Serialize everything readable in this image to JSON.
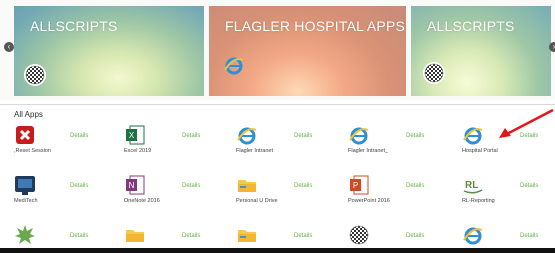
{
  "banners": [
    {
      "title": "ALLSCRIPTS",
      "logo": "checkered-ball-icon"
    },
    {
      "title": "FLAGLER HOSPITAL APPS",
      "logo": "ie-icon"
    },
    {
      "title": "ALLSCRIPTS",
      "logo": "checkered-ball-icon"
    }
  ],
  "nav": {
    "prev": "‹",
    "next": "›"
  },
  "all_apps_label": "All Apps",
  "details_label": "Details",
  "apps": [
    {
      "name": ",Reset Session",
      "icon": "red-x-icon"
    },
    {
      "name": "Excel 2019",
      "icon": "excel-icon"
    },
    {
      "name": "Flagler Intranet",
      "icon": "ie-icon"
    },
    {
      "name": "Flagler Intranet_",
      "icon": "ie-icon"
    },
    {
      "name": "Hospital Portal",
      "icon": "ie-icon"
    },
    {
      "name": "MediTech",
      "icon": "meditech-icon"
    },
    {
      "name": "OneNote 2016",
      "icon": "onenote-icon"
    },
    {
      "name": "Personal U Drive",
      "icon": "folder-icon"
    },
    {
      "name": "PowerPoint 2016",
      "icon": "powerpoint-icon"
    },
    {
      "name": "RL-Reporting",
      "icon": "rl-icon"
    },
    {
      "name": "",
      "icon": "green-burst-icon"
    },
    {
      "name": "",
      "icon": "folder-icon"
    },
    {
      "name": "",
      "icon": "folder-icon"
    },
    {
      "name": "",
      "icon": "checkered-ball-icon"
    },
    {
      "name": "",
      "icon": "ie-icon"
    }
  ],
  "colors": {
    "details": "#67b04a",
    "arrow": "#e3161b"
  }
}
